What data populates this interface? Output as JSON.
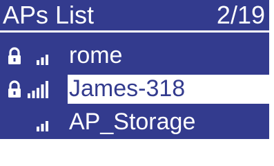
{
  "header": {
    "title": "APs List",
    "counter": "2/19"
  },
  "colors": {
    "background": "#333b8e",
    "foreground": "#ffffff",
    "selection_background": "#ffffff",
    "selection_text": "#333b8e"
  },
  "ap_list": [
    {
      "name": "rome",
      "secured": true,
      "signal_bars": 3,
      "selected": false,
      "lock_icon": "lock-icon",
      "signal_icon": "signal-strength-icon"
    },
    {
      "name": "James-318",
      "secured": true,
      "signal_bars": 5,
      "selected": true,
      "lock_icon": "lock-icon",
      "signal_icon": "signal-strength-icon"
    },
    {
      "name": "AP_Storage",
      "secured": false,
      "signal_bars": 3,
      "selected": false,
      "lock_icon": "",
      "signal_icon": "signal-strength-icon"
    }
  ]
}
